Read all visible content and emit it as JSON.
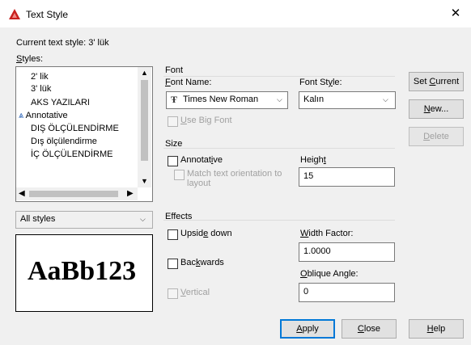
{
  "window": {
    "title": "Text Style",
    "close_glyph": "✕",
    "app_icon": "autocad-red-triangle-icon"
  },
  "current_style": {
    "label": "Current text style:",
    "value": "3' lük"
  },
  "styles": {
    "label": "Styles:",
    "items": [
      {
        "label": "2' lik",
        "annotative": false
      },
      {
        "label": "3' lük",
        "annotative": false
      },
      {
        "label": "AKS YAZILARI",
        "annotative": false
      },
      {
        "label": "Annotative",
        "annotative": true
      },
      {
        "label": "DIŞ ÖLÇÜLENDİRME",
        "annotative": false
      },
      {
        "label": "Dış ölçülendirme",
        "annotative": false
      },
      {
        "label": "İÇ ÖLÇÜLENDİRME",
        "annotative": false
      }
    ],
    "filter": "All styles"
  },
  "font": {
    "group_label": "Font",
    "name_label": "Font Name:",
    "name_value": "Times New Roman",
    "name_icon": "truetype-icon",
    "style_label": "Font Style:",
    "style_value": "Kalın",
    "use_big_font": "Use Big Font"
  },
  "size": {
    "group_label": "Size",
    "annotative": "Annotative",
    "match_orientation": "Match text orientation to layout",
    "height_label": "Height",
    "height_value": "15"
  },
  "effects": {
    "group_label": "Effects",
    "upside_down": "Upside down",
    "backwards": "Backwards",
    "vertical": "Vertical",
    "width_factor_label": "Width Factor:",
    "width_factor_value": "1.0000",
    "oblique_label": "Oblique Angle:",
    "oblique_value": "0"
  },
  "preview": {
    "sample": "AaBb123"
  },
  "buttons": {
    "set_current": "Set Current",
    "new": "New...",
    "delete": "Delete",
    "apply": "Apply",
    "close": "Close",
    "help": "Help"
  },
  "colors": {
    "accent": "#0078d7",
    "disabled_text": "#a0a0a0",
    "app_icon": "#c8201e"
  }
}
